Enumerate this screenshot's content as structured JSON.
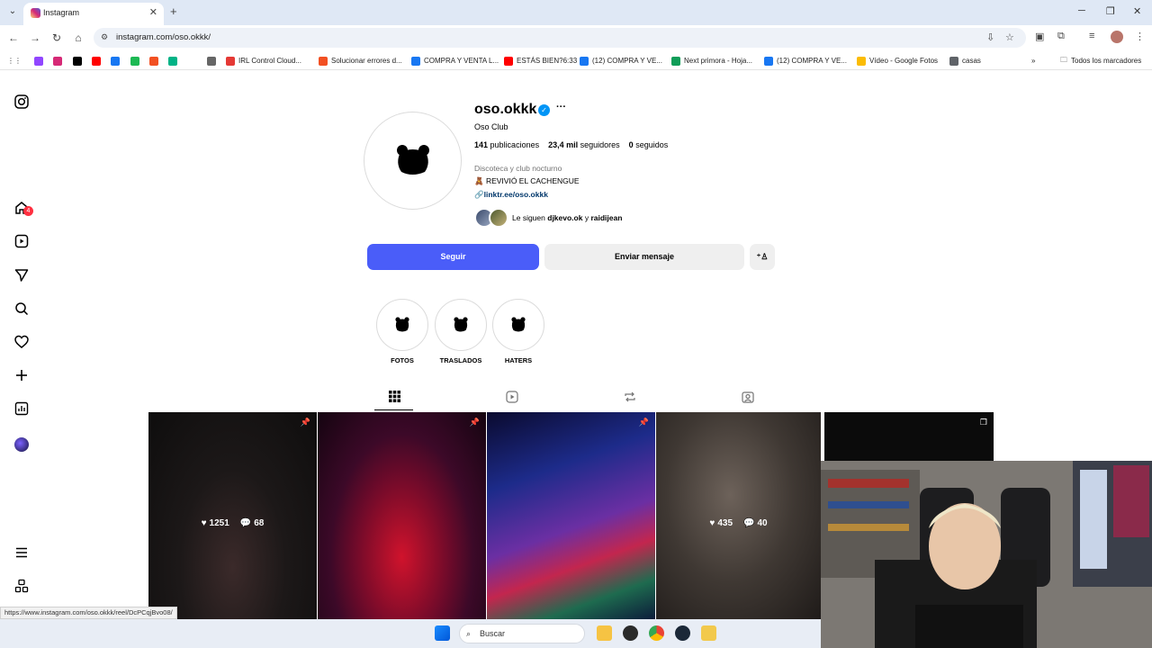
{
  "browser": {
    "tab_title": "Instagram",
    "url": "instagram.com/oso.okkk/",
    "bookmarks": [
      {
        "label": "",
        "color": "#9146ff"
      },
      {
        "label": "",
        "color": "#d62976"
      },
      {
        "label": "",
        "color": "#000000"
      },
      {
        "label": "",
        "color": "#ff0000"
      },
      {
        "label": "",
        "color": "#1877f2"
      },
      {
        "label": "",
        "color": "#1db954"
      },
      {
        "label": "",
        "color": "#f25022"
      },
      {
        "label": "",
        "color": "#00b386"
      },
      {
        "label": "",
        "color": "#666666"
      },
      {
        "label": "IRL Control Cloud...",
        "color": "#e53935"
      },
      {
        "label": "Solucionar errores d...",
        "color": "#f25022"
      },
      {
        "label": "COMPRA Y VENTA L...",
        "color": "#1877f2"
      },
      {
        "label": "ESTÁS BIEN?6:33",
        "color": "#ff0000"
      },
      {
        "label": "(12) COMPRA Y VE...",
        "color": "#1877f2"
      },
      {
        "label": "Next primora - Hoja...",
        "color": "#0f9d58"
      },
      {
        "label": "(12) COMPRA Y VE...",
        "color": "#1877f2"
      },
      {
        "label": "Vídeo - Google Fotos",
        "color": "#fbbc04"
      },
      {
        "label": "casas",
        "color": "#5f6368"
      }
    ],
    "all_bookmarks": "Todos los marcadores",
    "status_url": "https://www.instagram.com/oso.okkk/reel/DcPCqjBvo08/"
  },
  "rail": {
    "notification_count": "4"
  },
  "profile": {
    "username": "oso.okkk",
    "verified_mark": "✓",
    "more": "···",
    "full_name": "Oso Club",
    "posts_count": "141",
    "posts_label": "publicaciones",
    "followers_count": "23,4 mil",
    "followers_label": "seguidores",
    "following_count": "0",
    "following_label": "seguidos",
    "category": "Discoteca y club nocturno",
    "bio": "🧸 REVIVIÓ EL CACHENGUE",
    "link": "linktr.ee/oso.okkk",
    "followed_by_prefix": "Le siguen",
    "followed_by_1": "djkevo.ok",
    "followed_by_and": "y",
    "followed_by_2": "raidijean",
    "follow_button": "Seguir",
    "message_button": "Enviar mensaje"
  },
  "highlights": [
    {
      "label": "FOTOS"
    },
    {
      "label": "TRASLADOS"
    },
    {
      "label": "HATERS"
    }
  ],
  "posts": [
    {
      "likes": "1251",
      "comments": "68",
      "pinned": true
    },
    {
      "likes": "",
      "comments": "",
      "pinned": true
    },
    {
      "likes": "",
      "comments": "",
      "pinned": true
    },
    {
      "likes": "435",
      "comments": "40",
      "pinned": false
    },
    {
      "likes": "",
      "comments": "",
      "pinned": false
    }
  ],
  "taskbar": {
    "search_placeholder": "Buscar"
  },
  "colors": {
    "follow_button": "#4a5df9",
    "link": "#00376b",
    "badge": "#ff3040",
    "verified": "#0095f6"
  }
}
